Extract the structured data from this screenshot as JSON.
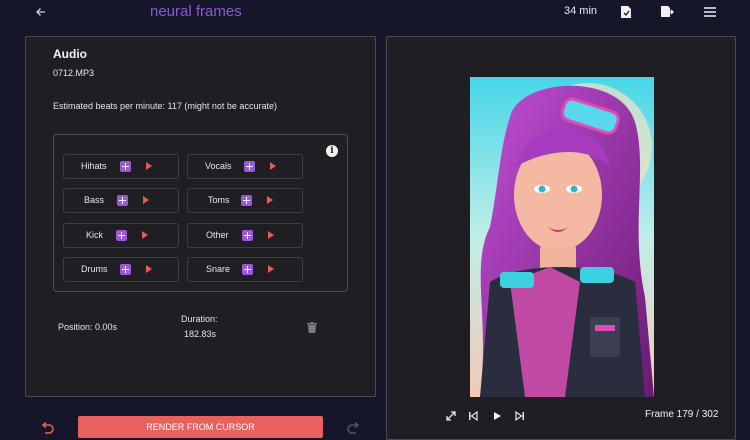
{
  "header": {
    "brand": "neural frames",
    "credits": "34 min"
  },
  "audio": {
    "title": "Audio",
    "filename": "0712.MP3",
    "bpm_text": "Estimated beats per minute: 117 (might not be accurate)",
    "stems": [
      {
        "label": "Hihats"
      },
      {
        "label": "Vocals"
      },
      {
        "label": "Bass"
      },
      {
        "label": "Toms"
      },
      {
        "label": "Kick"
      },
      {
        "label": "Other"
      },
      {
        "label": "Drums"
      },
      {
        "label": "Snare"
      }
    ],
    "position_text": "Position: 0.00s",
    "duration_label": "Duration:",
    "duration_value": "182.83s"
  },
  "footer": {
    "render_label": "RENDER FROM CURSOR"
  },
  "player": {
    "frame_text": "Frame 179 / 302"
  },
  "colors": {
    "accent_purple": "#9b59d8",
    "accent_red": "#e8615e",
    "background": "#16162a",
    "panel": "#1f1f23"
  },
  "icons": [
    "back-arrow-icon",
    "document-check-icon",
    "export-icon",
    "menu-icon",
    "info-icon",
    "plus-icon",
    "play-icon",
    "trash-icon",
    "expand-icon",
    "skip-back-icon",
    "skip-forward-icon",
    "undo-icon",
    "redo-icon"
  ]
}
